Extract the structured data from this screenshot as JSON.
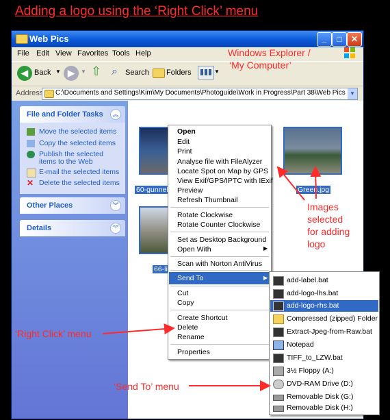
{
  "banner": "Adding a logo using the ‘Right Click’ menu",
  "window": {
    "title": "Web Pics",
    "menu": [
      "File",
      "Edit",
      "View",
      "Favorites",
      "Tools",
      "Help"
    ],
    "toolbar": {
      "back": "Back",
      "search": "Search",
      "folders": "Folders"
    },
    "address": {
      "label": "Address",
      "path": "C:\\Documents and Settings\\Kim\\My Documents\\Photoguide\\Work in Progress\\Part 38\\Web Pics"
    }
  },
  "sidebar": {
    "tasks_title": "File and Folder Tasks",
    "tasks": [
      "Move the selected items",
      "Copy the selected items",
      "Publish the selected items to the Web",
      "E-mail the selected items",
      "Delete the selected items"
    ],
    "other_places": "Other Places",
    "details": "Details"
  },
  "files": [
    {
      "caption": "60-gunnels-"
    },
    {
      "caption": ""
    },
    {
      "caption": "Green.jpg"
    },
    {
      "caption": "66-lin"
    }
  ],
  "context_menu": {
    "items": [
      "Open",
      "Edit",
      "Print",
      "Analyse file with FileAlyzer",
      "Locate Spot on Map by GPS",
      "View Exif/GPS/IPTC with IExif",
      "Preview",
      "Refresh Thumbnail",
      "Rotate Clockwise",
      "Rotate Counter Clockwise",
      "Set as Desktop Background",
      "Open With",
      "Scan with Norton AntiVirus",
      "Send To",
      "Cut",
      "Copy",
      "Create Shortcut",
      "Delete",
      "Rename",
      "Properties"
    ]
  },
  "send_to": {
    "items": [
      "add-label.bat",
      "add-logo-lhs.bat",
      "add-logo-rhs.bat",
      "Compressed (zipped) Folder",
      "Extract-Jpeg-from-Raw.bat",
      "Notepad",
      "TIFF_to_LZW.bat",
      "3½ Floppy (A:)",
      "DVD-RAM Drive (D:)",
      "Removable Disk (G:)",
      "Removable Disk (H:)"
    ]
  },
  "annotations": {
    "explorer": "Windows Explorer /",
    "explorer2": "‘My Computer’",
    "images_selected": [
      "Images",
      "selected",
      "for adding",
      "logo"
    ],
    "right_click": "‘Right Click’ menu",
    "send_to": "‘Send To’ menu"
  }
}
